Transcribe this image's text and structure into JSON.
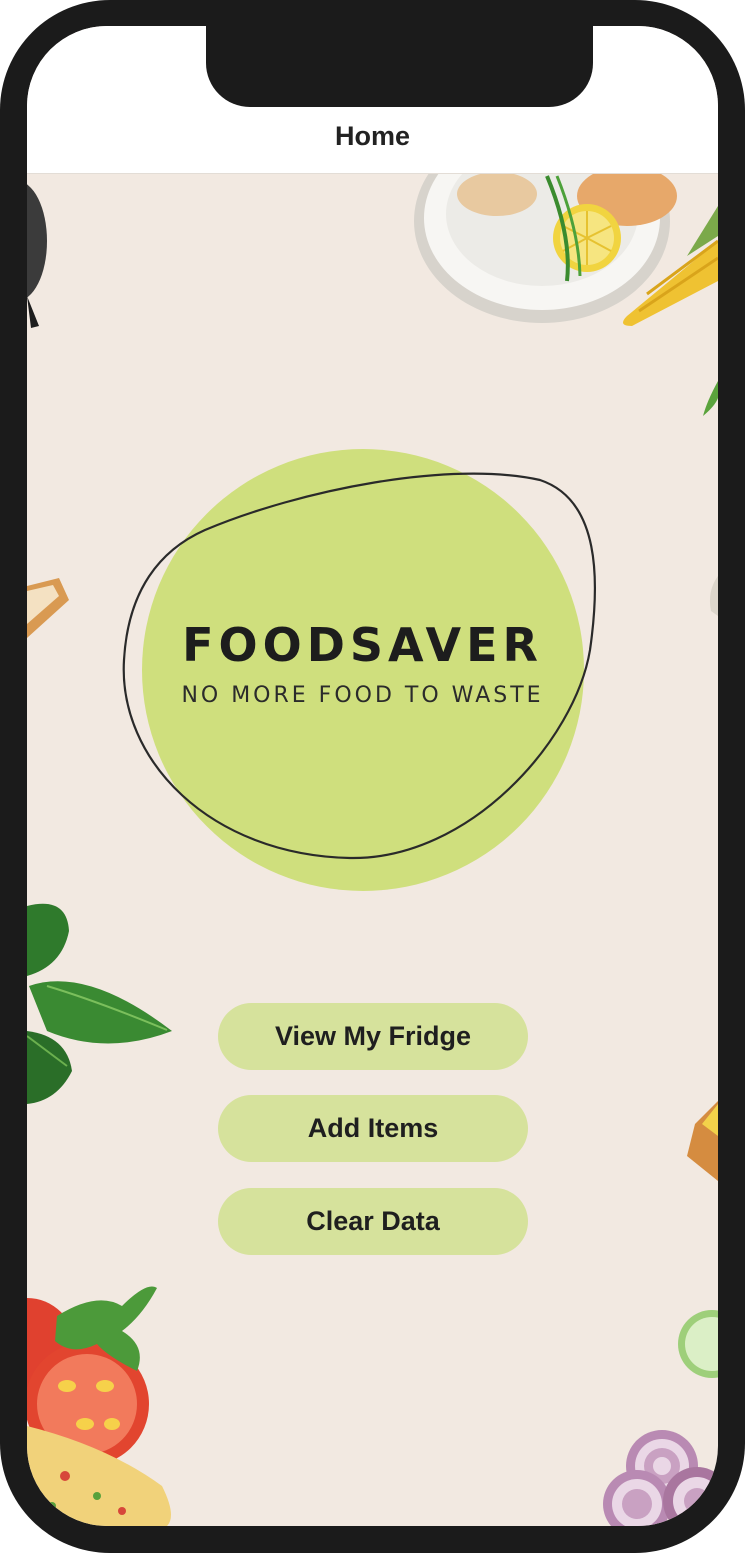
{
  "navbar": {
    "title": "Home"
  },
  "brand": {
    "name": "FOODSAVER",
    "tagline": "NO MORE FOOD TO WASTE",
    "accent_color": "#cfdf7d"
  },
  "buttons": [
    {
      "label": "View My Fridge"
    },
    {
      "label": "Add Items"
    },
    {
      "label": "Clear Data"
    }
  ],
  "colors": {
    "background": "#f2e9e1",
    "button": "#d6e29c",
    "frame": "#1b1b1b"
  },
  "decorations": [
    "plate-with-lemon-icon",
    "corn-icon",
    "basil-leaves-icon",
    "tomato-icon",
    "omelette-icon",
    "onion-icon",
    "cucumber-icon",
    "pan-icon",
    "toast-icon",
    "cheese-icon"
  ]
}
